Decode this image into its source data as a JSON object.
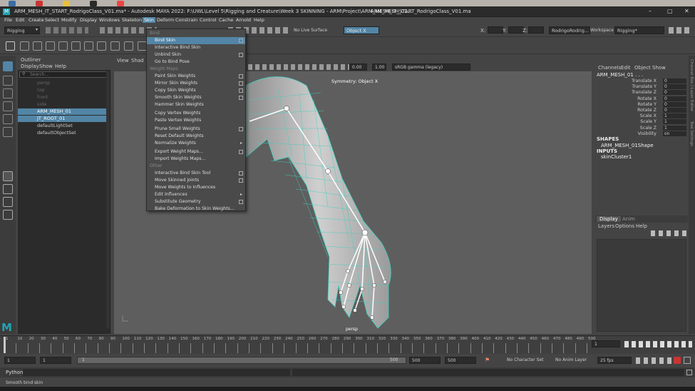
{
  "window": {
    "title": "ARM_MESH_IT_START_RodrigoClass_V01.ma* - Autodesk MAYA 2022: F:\\UWL\\Level 5\\Rigging and Creature\\Week 3 SKINNING - ARM\\Project\\ARM_MESH_IT_START_RodrigoClass_V01.ma",
    "second_tab": "ARM_MESH_01..."
  },
  "menubar": [
    "File",
    "Edit",
    "Create",
    "Select",
    "Modify",
    "Display",
    "Windows",
    "Skeleton",
    "Skin",
    "Deform",
    "Constrain",
    "Control",
    "Cache",
    "Arnold",
    "Help"
  ],
  "toolbar": {
    "mode": "Rigging",
    "live_surface": "No Live Surface",
    "object_x": "Object X",
    "x_label": "X:",
    "y_label": "Y:",
    "z_label": "Z:",
    "user": "RodrigoRodrig...",
    "workspace_label": "Workspace :",
    "workspace": "Rigging*"
  },
  "outliner": {
    "title": "Outliner",
    "menus": [
      "Display",
      "Show",
      "Help"
    ],
    "search_placeholder": "Search...",
    "items": [
      "persp",
      "top",
      "front",
      "side",
      "ARM_MESH_01",
      "JT_ROOT_01",
      "defaultLightSet",
      "defaultObjectSet"
    ]
  },
  "viewport": {
    "menus": [
      "View",
      "Shad"
    ],
    "value1": "0.00",
    "value2": "1.00",
    "colorspace": "sRGB gamma (legacy)",
    "symmetry": "Symmetry: Object X",
    "camera": "persp"
  },
  "skin_menu": {
    "section_bind": "Bind",
    "items_bind": [
      "Bind Skin",
      "Interactive Bind Skin",
      "Unbind Skin",
      "Go to Bind Pose"
    ],
    "section_weight": "Weight Maps",
    "items_weight": [
      "Paint Skin Weights",
      "Mirror Skin Weights",
      "Copy Skin Weights",
      "Smooth Skin Weights",
      "Hammer Skin Weights",
      "Copy Vertex Weights",
      "Paste Vertex Weights",
      "Prune Small Weights",
      "Reset Default Weights",
      "Normalize Weights",
      "Export Weight Maps...",
      "Import Weights Maps..."
    ],
    "section_other": "Other",
    "items_other": [
      "Interactive Bind Skin Tool",
      "Move Skinned Joints",
      "Move Weights to Influences",
      "Edit Influences",
      "Substitute Geometry",
      "Bake Deformation to Skin Weights..."
    ]
  },
  "channel_box": {
    "menus": [
      "Channels",
      "Edit",
      "Object",
      "Show"
    ],
    "object": "ARM_MESH_01 . . .",
    "attrs": [
      {
        "name": "Translate X",
        "value": "0"
      },
      {
        "name": "Translate Y",
        "value": "0"
      },
      {
        "name": "Translate Z",
        "value": "0"
      },
      {
        "name": "Rotate X",
        "value": "0"
      },
      {
        "name": "Rotate Y",
        "value": "0"
      },
      {
        "name": "Rotate Z",
        "value": "0"
      },
      {
        "name": "Scale X",
        "value": "1"
      },
      {
        "name": "Scale Y",
        "value": "1"
      },
      {
        "name": "Scale Z",
        "value": "1"
      },
      {
        "name": "Visibility",
        "value": "on"
      }
    ],
    "shapes_label": "SHAPES",
    "shape": "ARM_MESH_01Shape",
    "inputs_label": "INPUTS",
    "input": "skinCluster1",
    "layer_tabs": [
      "Display",
      "Anim"
    ],
    "layer_menus": [
      "Layers",
      "Options",
      "Help"
    ]
  },
  "side_tabs": [
    "Channel Box / Layer Editor",
    "Tool Settings"
  ],
  "timeline": {
    "ticks": [
      "1",
      "10",
      "20",
      "30",
      "40",
      "50",
      "60",
      "70",
      "80",
      "90",
      "100",
      "110",
      "120",
      "130",
      "140",
      "150",
      "160",
      "170",
      "180",
      "190",
      "200",
      "210",
      "220",
      "230",
      "240",
      "250",
      "260",
      "270",
      "280",
      "290",
      "300",
      "310",
      "320",
      "330",
      "340",
      "350",
      "360",
      "370",
      "380",
      "390",
      "400",
      "410",
      "420",
      "430",
      "440",
      "450",
      "460",
      "470",
      "480",
      "490",
      "500"
    ],
    "current": "1"
  },
  "range": {
    "start": "1",
    "start2": "1",
    "slider_start": "1",
    "slider_end": "500",
    "end": "500",
    "end2": "500",
    "character_set": "No Character Set",
    "anim_layer": "No Anim Layer",
    "fps": "25 fps"
  },
  "command_line": {
    "label": "Python"
  },
  "help_line": {
    "text": "Smooth bind skin"
  }
}
